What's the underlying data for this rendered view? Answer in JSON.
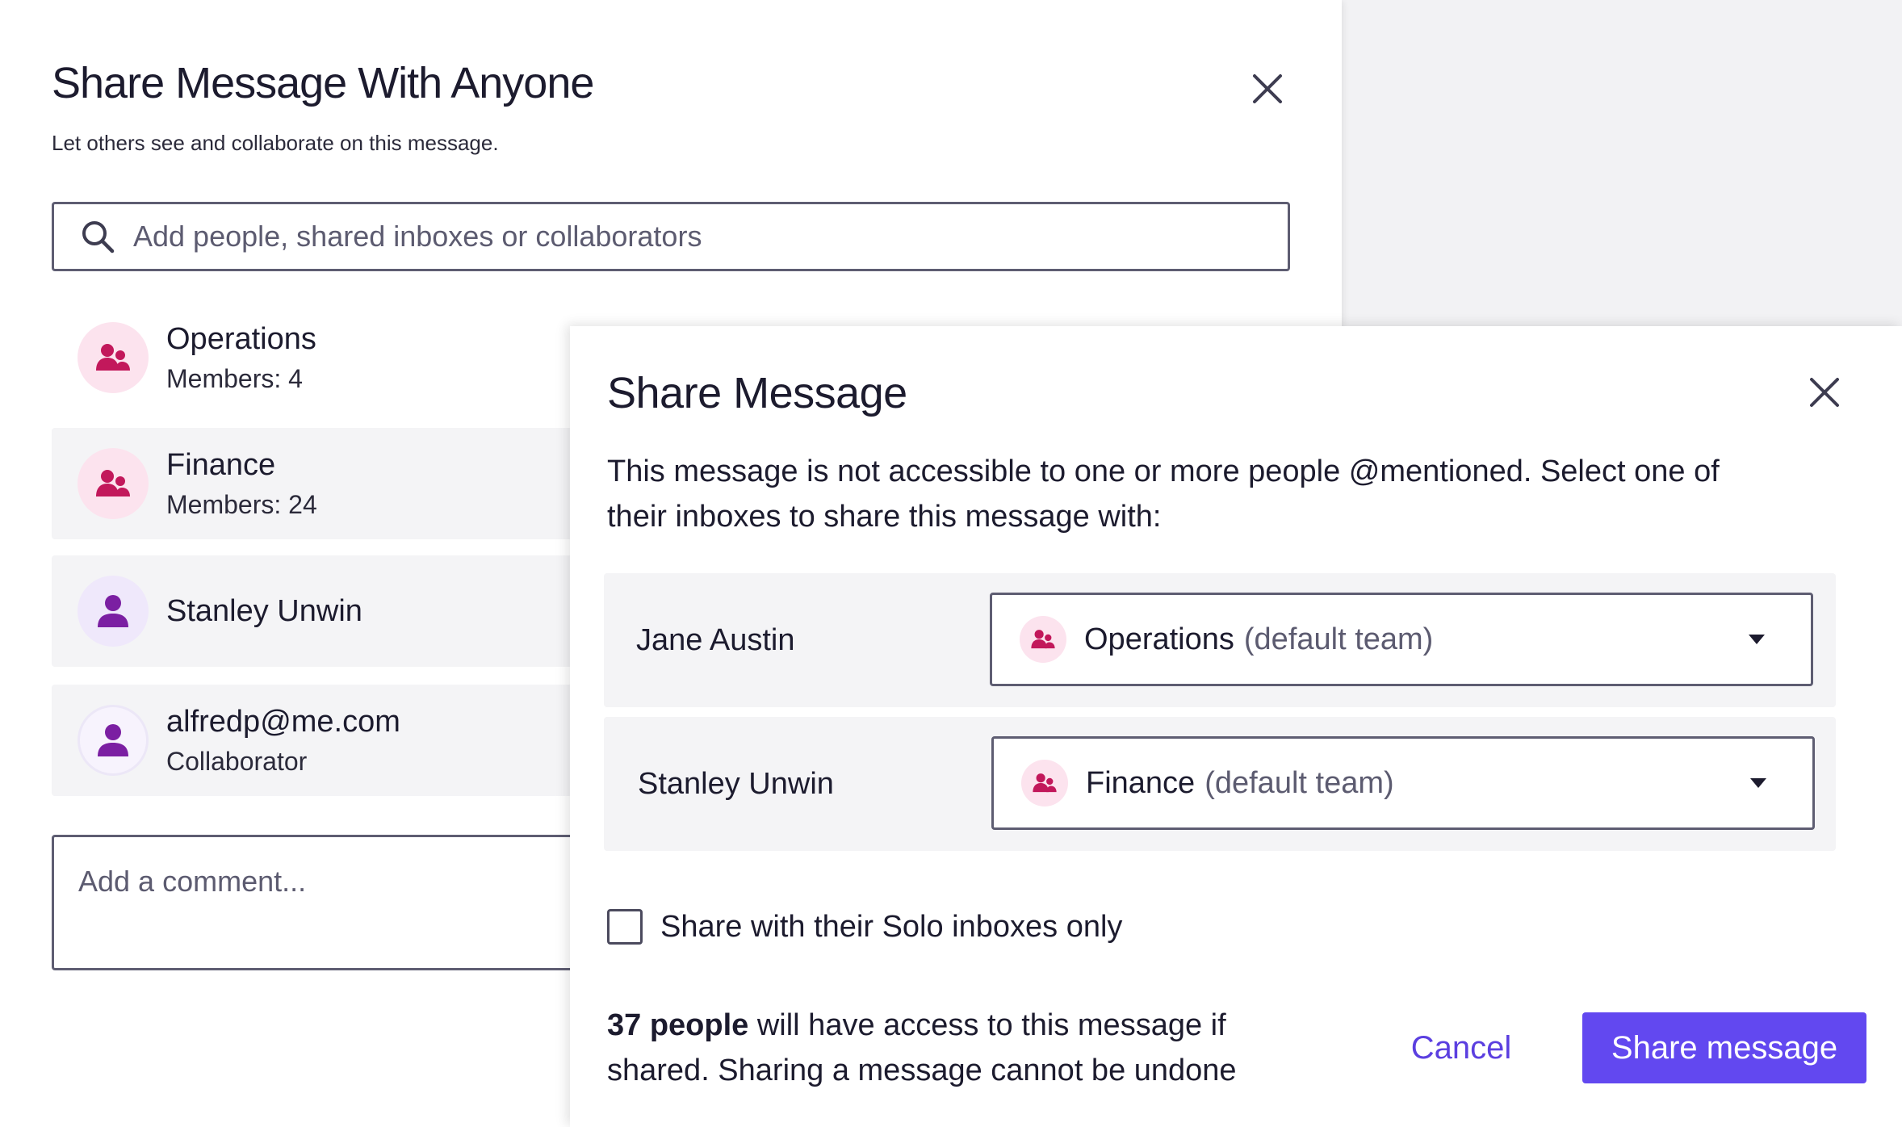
{
  "background_dialog": {
    "title": "Share Message With Anyone",
    "subtitle": "Let others see and collaborate on this message.",
    "search_placeholder": "Add people, shared inboxes or collaborators",
    "recipients": [
      {
        "name": "Operations",
        "sub": "Members: 4",
        "kind": "team",
        "icon": "team-icon"
      },
      {
        "name": "Finance",
        "sub": "Members: 24",
        "kind": "team",
        "icon": "team-icon"
      },
      {
        "name": "Stanley Unwin",
        "sub": "",
        "kind": "user",
        "icon": "user-icon"
      },
      {
        "name": "alfredp@me.com",
        "sub": "Collaborator",
        "kind": "collaborator",
        "icon": "user-icon"
      }
    ],
    "comment_placeholder": "Add a comment..."
  },
  "share_dialog": {
    "title": "Share Message",
    "description": "This message is not accessible to one or more people @mentioned. Select one of their inboxes to share this message with:",
    "mappings": [
      {
        "person": "Jane Austin",
        "inbox": "Operations",
        "suffix": "(default team)"
      },
      {
        "person": "Stanley Unwin",
        "inbox": "Finance",
        "suffix": "(default team)"
      }
    ],
    "solo_checkbox_label": "Share with their Solo inboxes only",
    "solo_checked": false,
    "footer_bold": "37 people",
    "footer_rest": " will have access to this message if shared. Sharing a message cannot be undone",
    "cancel_label": "Cancel",
    "share_label": "Share message"
  },
  "colors": {
    "accent": "#6248f0",
    "link": "#5b3fe0",
    "team_icon": "#c2185b",
    "team_bg": "#fce3ee",
    "user_icon": "#7b1fa2",
    "user_bg": "#efe8fb"
  }
}
